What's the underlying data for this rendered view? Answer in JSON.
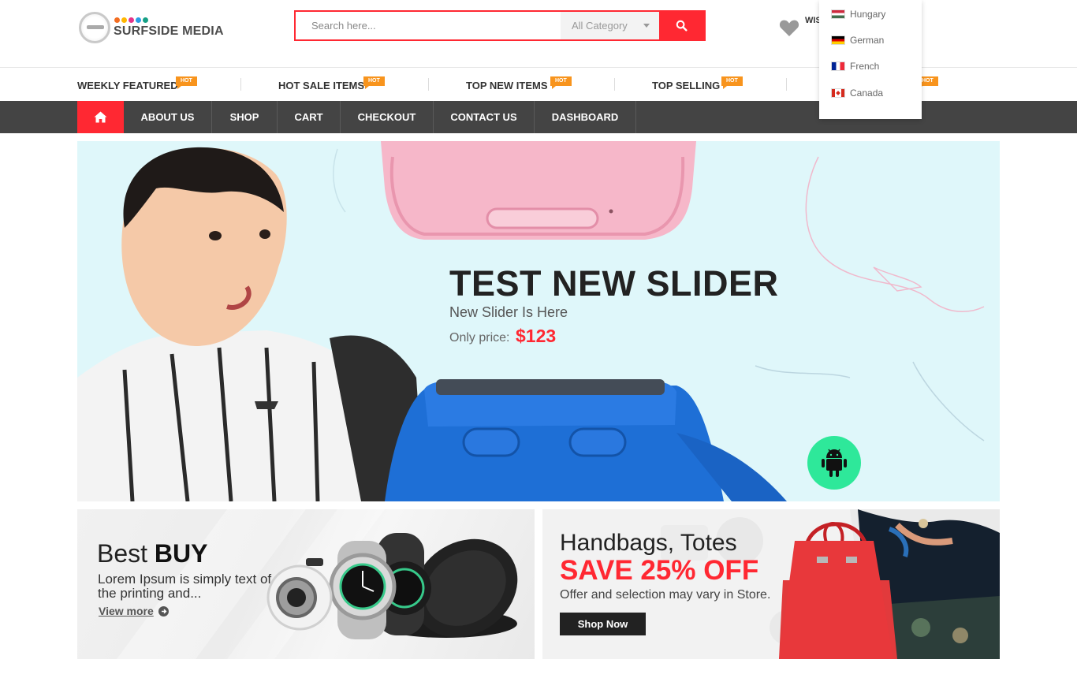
{
  "header": {
    "logo_text": "SURFSIDE MEDIA",
    "logo_dot_colors": [
      "#f36d21",
      "#ffb700",
      "#e6338a",
      "#2b9de5",
      "#16a085"
    ],
    "search": {
      "placeholder": "Search here...",
      "category": "All Category"
    },
    "wishlist_label": "WIS",
    "languages": [
      {
        "name": "Hungary",
        "flag": "hungary-flag-icon"
      },
      {
        "name": "German",
        "flag": "german-flag-icon"
      },
      {
        "name": "French",
        "flag": "french-flag-icon"
      },
      {
        "name": "Canada",
        "flag": "canada-flag-icon"
      }
    ]
  },
  "featured_strip": {
    "items": [
      {
        "label": "WEEKLY FEATURED",
        "badge": "HOT"
      },
      {
        "label": "HOT SALE ITEMS",
        "badge": "HOT"
      },
      {
        "label": "TOP NEW ITEMS",
        "badge": "HOT"
      },
      {
        "label": "TOP SELLING",
        "badge": "HOT"
      },
      {
        "label": "",
        "badge": "HOT"
      }
    ]
  },
  "nav": {
    "home_icon": "home-icon",
    "items": [
      "ABOUT US",
      "SHOP",
      "CART",
      "CHECKOUT",
      "CONTACT US",
      "DASHBOARD"
    ]
  },
  "hero": {
    "title": "TEST NEW SLIDER",
    "subtitle": "New Slider Is Here",
    "price_label": "Only price:",
    "price": "$123",
    "badge_icon": "android-icon"
  },
  "banners": {
    "left": {
      "title_light": "Best ",
      "title_bold": "BUY",
      "description": "Lorem Ipsum is simply text of the printing and...",
      "link": "View more"
    },
    "right": {
      "title": "Handbags, Totes",
      "save": "SAVE 25% OFF",
      "note": "Offer and selection may vary in Store.",
      "button": "Shop Now"
    }
  },
  "colors": {
    "accent": "#ff2832",
    "nav_bg": "#444444",
    "hot_badge": "#f8941d",
    "hero_bg": "#dff7fa",
    "android_badge": "#2ee89a"
  }
}
